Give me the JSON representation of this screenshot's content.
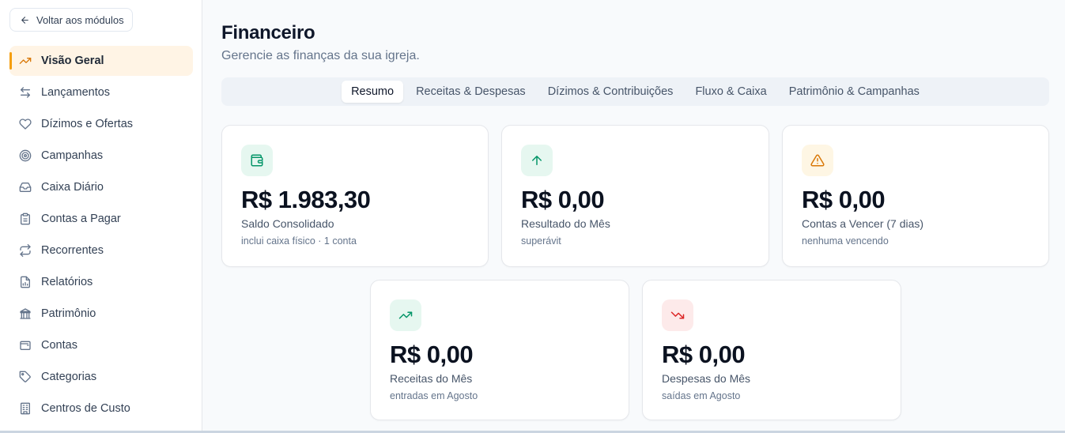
{
  "sidebar": {
    "back_label": "Voltar aos módulos",
    "items": [
      {
        "label": "Visão Geral",
        "icon": "trending-up-icon",
        "active": true
      },
      {
        "label": "Lançamentos",
        "icon": "arrows-swap-icon"
      },
      {
        "label": "Dízimos e Ofertas",
        "icon": "heart-icon"
      },
      {
        "label": "Campanhas",
        "icon": "target-icon"
      },
      {
        "label": "Caixa Diário",
        "icon": "inbox-icon"
      },
      {
        "label": "Contas a Pagar",
        "icon": "clipboard-icon"
      },
      {
        "label": "Recorrentes",
        "icon": "repeat-icon"
      },
      {
        "label": "Relatórios",
        "icon": "report-icon"
      },
      {
        "label": "Patrimônio",
        "icon": "bank-icon"
      },
      {
        "label": "Contas",
        "icon": "wallet-icon"
      },
      {
        "label": "Categorias",
        "icon": "tag-icon"
      },
      {
        "label": "Centros de Custo",
        "icon": "building-icon"
      }
    ]
  },
  "header": {
    "title": "Financeiro",
    "subtitle": "Gerencie as finanças da sua igreja."
  },
  "tabs": [
    {
      "label": "Resumo",
      "active": true
    },
    {
      "label": "Receitas & Despesas"
    },
    {
      "label": "Dízimos & Contribuições"
    },
    {
      "label": "Fluxo & Caixa"
    },
    {
      "label": "Patrimônio & Campanhas"
    }
  ],
  "cards": [
    {
      "value": "R$ 1.983,30",
      "label": "Saldo Consolidado",
      "note": "inclui caixa físico · 1 conta",
      "icon": "wallet-icon",
      "icon_color": "#059669",
      "icon_bg": "#e6f7f0"
    },
    {
      "value": "R$ 0,00",
      "label": "Resultado do Mês",
      "note": "superávit",
      "icon": "arrow-up-icon",
      "icon_color": "#059669",
      "icon_bg": "#e6f7f0"
    },
    {
      "value": "R$ 0,00",
      "label": "Contas a Vencer (7 dias)",
      "note": "nenhuma vencendo",
      "icon": "warning-icon",
      "icon_color": "#d97706",
      "icon_bg": "#fef6e4"
    },
    {
      "value": "R$ 0,00",
      "label": "Receitas do Mês",
      "note": "entradas em Agosto",
      "icon": "trending-up-icon",
      "icon_color": "#059669",
      "icon_bg": "#e6f7f0"
    },
    {
      "value": "R$ 0,00",
      "label": "Despesas do Mês",
      "note": "saídas em Agosto",
      "icon": "trending-down-icon",
      "icon_color": "#dc2626",
      "icon_bg": "#fdeaea"
    }
  ],
  "colors": {
    "accent": "#f59e0b",
    "active_bg": "#fff4e5"
  }
}
